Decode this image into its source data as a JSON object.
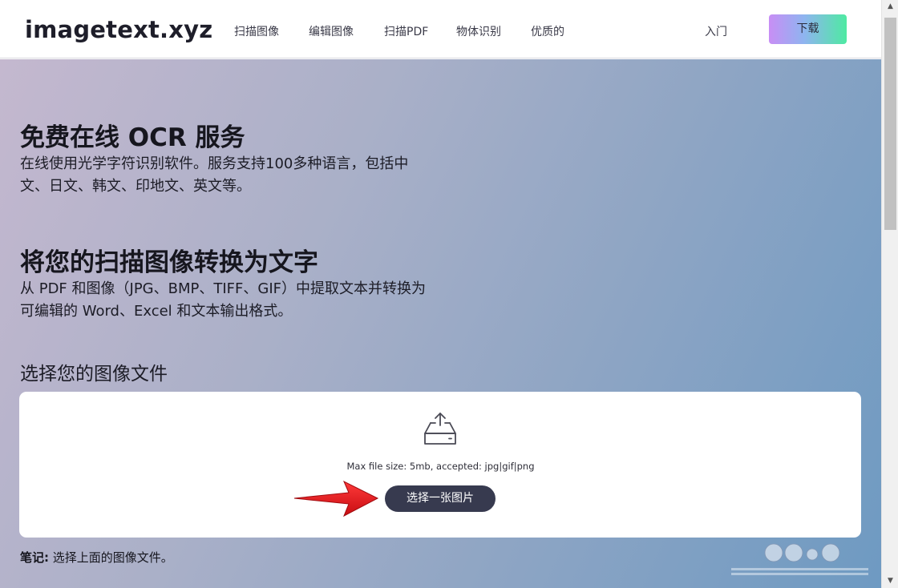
{
  "header": {
    "logo": "imagetext.xyz",
    "nav": [
      "扫描图像",
      "编辑图像",
      "扫描PDF",
      "物体识别",
      "优质的"
    ],
    "getting_started": "入门",
    "download_label": "下载"
  },
  "hero": {
    "title1": "免费在线 OCR 服务",
    "desc1": "在线使用光学字符识别软件。服务支持100多种语言，包括中文、日文、韩文、印地文、英文等。",
    "title2": "将您的扫描图像转换为文字",
    "desc2": "从 PDF 和图像（JPG、BMP、TIFF、GIF）中提取文本并转换为可编辑的 Word、Excel 和文本输出格式。",
    "choose_heading": "选择您的图像文件"
  },
  "upload": {
    "limits": "Max file size: 5mb, accepted: jpg|gif|png",
    "button_label": "选择一张图片",
    "icon": "upload-tray-icon"
  },
  "note": {
    "label": "笔记:",
    "text": " 选择上面的图像文件。"
  },
  "colors": {
    "button_dark": "#373a4f",
    "arrow_red": "#e0141b",
    "download_gradient": [
      "#c88ef5",
      "#8fb4f0",
      "#4eeaa2"
    ]
  }
}
